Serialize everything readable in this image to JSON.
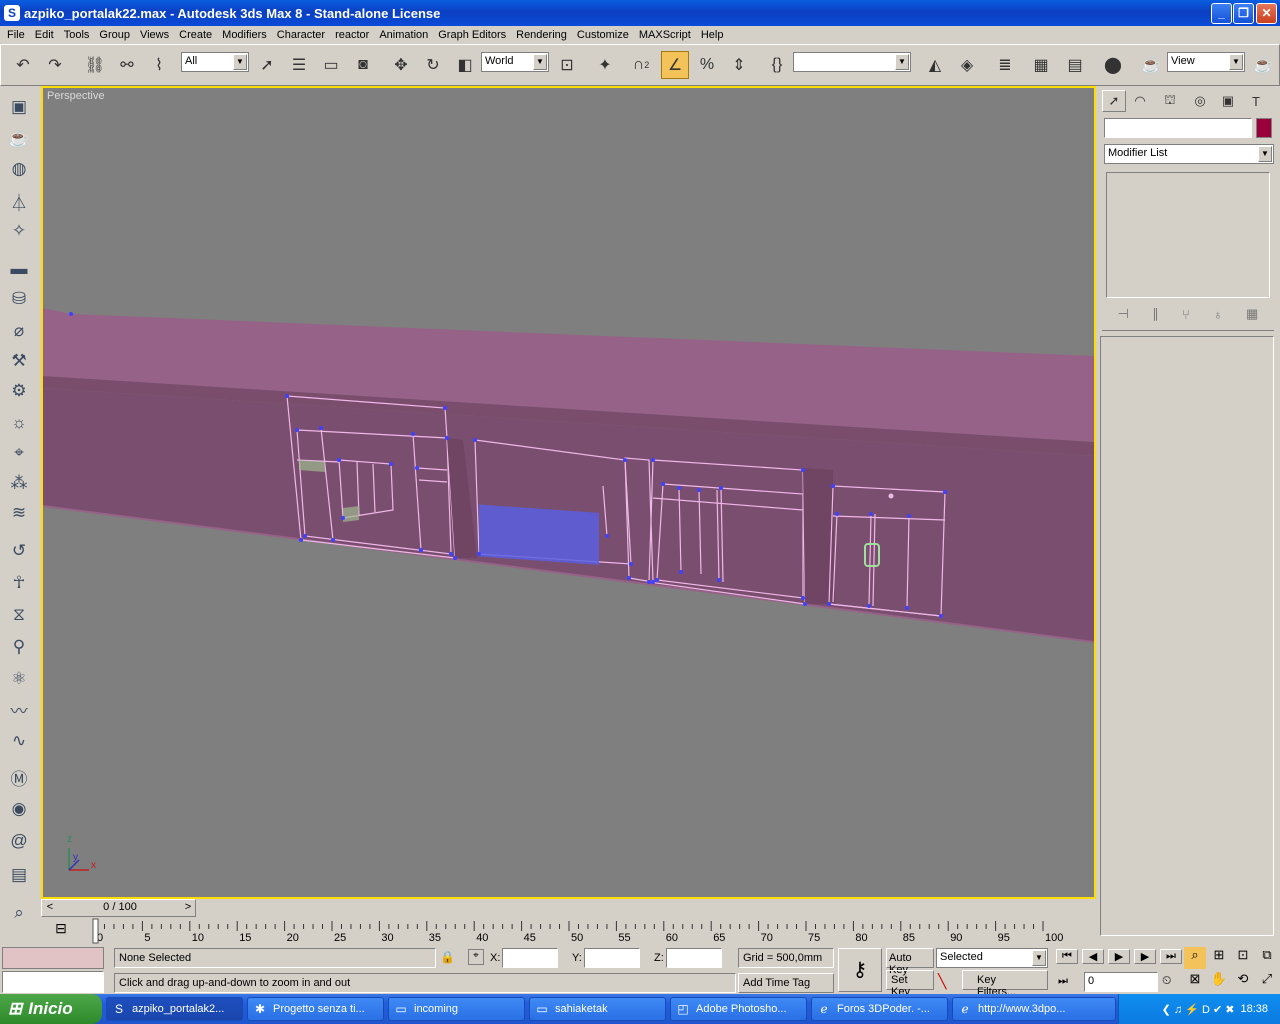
{
  "window": {
    "title": "azpiko_portalak22.max - Autodesk 3ds Max 8  - Stand-alone License",
    "min": "_",
    "max": "❐",
    "close": "✕"
  },
  "menu": [
    "File",
    "Edit",
    "Tools",
    "Group",
    "Views",
    "Create",
    "Modifiers",
    "Character",
    "reactor",
    "Animation",
    "Graph Editors",
    "Rendering",
    "Customize",
    "MAXScript",
    "Help"
  ],
  "toolbar": {
    "selection_filter": "All",
    "ref_coord": "World",
    "named_sel": "",
    "view": "View",
    "snap_count": "2",
    "percent": "%"
  },
  "viewport": {
    "label": "Perspective",
    "axes": {
      "x": "x",
      "y": "y",
      "z": "z"
    }
  },
  "cmdpanel": {
    "name_field": "",
    "modifier_list": "Modifier List",
    "swatch_color": "#99003a"
  },
  "timeslider": {
    "frame": "0 / 100",
    "prev": "<",
    "next": ">"
  },
  "trackbar": {
    "ticks": [
      "0",
      "5",
      "10",
      "15",
      "20",
      "25",
      "30",
      "35",
      "40",
      "45",
      "50",
      "55",
      "60",
      "65",
      "70",
      "75",
      "80",
      "85",
      "90",
      "95",
      "100"
    ]
  },
  "status": {
    "selection": "None Selected",
    "prompt": "Click and drag up-and-down to zoom in and out",
    "x_label": "X:",
    "y_label": "Y:",
    "z_label": "Z:",
    "x": "",
    "y": "",
    "z": "",
    "grid": "Grid = 500,0mm",
    "add_time_tag": "Add Time Tag",
    "auto_key": "Auto Key",
    "set_key": "Set Key",
    "selected": "Selected",
    "key_filters": "Key Filters...",
    "frame": "0"
  },
  "taskbar": {
    "start": "Inicio",
    "tasks": [
      {
        "icon": "3ds",
        "label": "azpiko_portalak2..."
      },
      {
        "icon": "star",
        "label": "Progetto senza ti..."
      },
      {
        "icon": "folder",
        "label": "incoming"
      },
      {
        "icon": "folder",
        "label": "sahiaketak"
      },
      {
        "icon": "ps",
        "label": "Adobe Photosho..."
      },
      {
        "icon": "ie",
        "label": "Foros 3DPoder. -..."
      },
      {
        "icon": "ie",
        "label": "http://www.3dpo..."
      }
    ],
    "clock": "18:38"
  }
}
